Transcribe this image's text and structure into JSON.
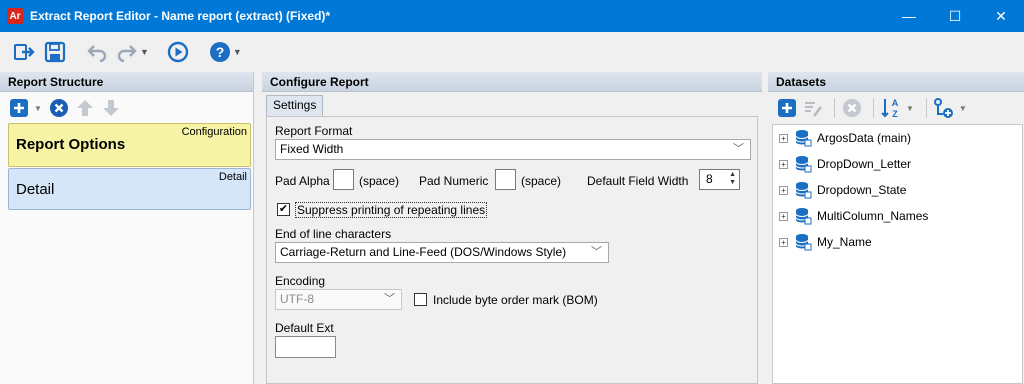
{
  "window": {
    "app_icon_text": "Ar",
    "title": "Extract Report Editor - Name report (extract) (Fixed)*",
    "minimize": "—",
    "maximize": "☐",
    "close": "✕"
  },
  "toolbar": {
    "icons": [
      "save-close-icon",
      "save-icon",
      "undo-icon",
      "redo-icon",
      "run-icon",
      "help-icon"
    ]
  },
  "report_structure": {
    "header": "Report Structure",
    "sections": [
      {
        "tag": "Configuration",
        "title": "Report Options",
        "color": "#f7f3a4"
      },
      {
        "tag": "Detail",
        "title": "Detail",
        "color": "#d5e6f8"
      }
    ]
  },
  "configure": {
    "header": "Configure Report",
    "tab": "Settings",
    "report_format_label": "Report Format",
    "report_format_value": "Fixed Width",
    "pad_alpha_label": "Pad Alpha",
    "pad_alpha_hint": "(space)",
    "pad_numeric_label": "Pad Numeric",
    "pad_numeric_hint": "(space)",
    "default_field_width_label": "Default Field Width",
    "default_field_width_value": "8",
    "suppress_label": "Suppress printing of repeating lines",
    "suppress_checked": true,
    "eol_label": "End of line characters",
    "eol_value": "Carriage-Return and Line-Feed (DOS/Windows Style)",
    "encoding_label": "Encoding",
    "encoding_value": "UTF-8",
    "bom_label": "Include byte order mark (BOM)",
    "bom_checked": false,
    "default_ext_label": "Default Ext",
    "default_ext_value": ""
  },
  "datasets": {
    "header": "Datasets",
    "items": [
      "ArgosData (main)",
      "DropDown_Letter",
      "Dropdown_State",
      "MultiColumn_Names",
      "My_Name"
    ]
  },
  "colors": {
    "titlebar": "#0078d7",
    "accent_blue": "#1b6ec2",
    "delete_blue": "#1a5fb4"
  }
}
